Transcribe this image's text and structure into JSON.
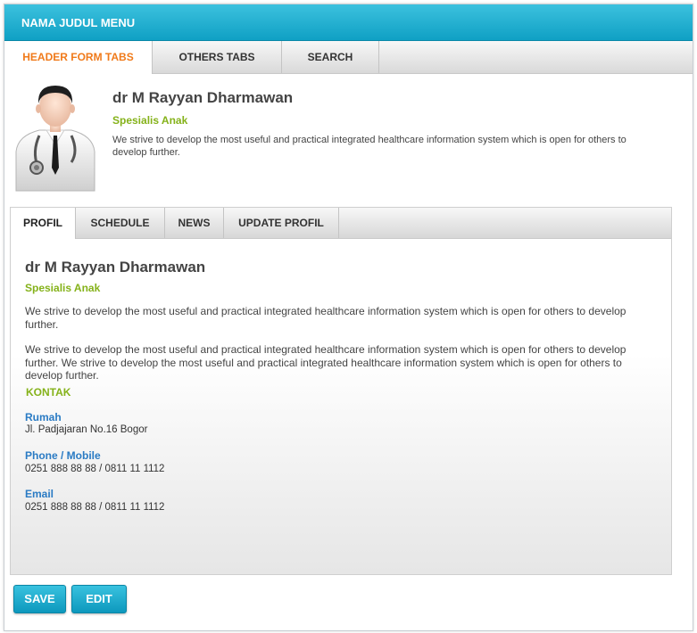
{
  "window": {
    "title": "NAMA JUDUL MENU"
  },
  "top_tabs": [
    {
      "label": "HEADER FORM TABS"
    },
    {
      "label": "OTHERS TABS"
    },
    {
      "label": "SEARCH"
    }
  ],
  "header": {
    "name": "dr M Rayyan Dharmawan",
    "specialty": "Spesialis Anak",
    "description": "We strive to develop the most useful and practical integrated healthcare information system which is open for others to develop further."
  },
  "inner_tabs": [
    {
      "label": "PROFIL"
    },
    {
      "label": "SCHEDULE"
    },
    {
      "label": "NEWS"
    },
    {
      "label": "UPDATE PROFIL"
    }
  ],
  "profile": {
    "name": "dr M Rayyan Dharmawan",
    "specialty": "Spesialis Anak",
    "paragraph1": "We strive to develop the most useful and practical integrated healthcare information system which is open for others to develop further.",
    "paragraph2": "We strive to develop the most useful and practical integrated healthcare information system which is open for others to develop further. We strive to develop the most useful and practical integrated healthcare information system which is open for others to develop further.",
    "kontak_title": "KONTAK",
    "contacts": [
      {
        "label": "Rumah",
        "value": "Jl. Padjajaran No.16 Bogor"
      },
      {
        "label": "Phone / Mobile",
        "value": "0251 888 88 88 / 0811 11 1112"
      },
      {
        "label": "Email",
        "value": "0251 888 88 88 / 0811 11 1112"
      }
    ]
  },
  "buttons": {
    "save": "SAVE",
    "edit": "EDIT"
  },
  "colors": {
    "accent": "#0fa0c4",
    "active_tab": "#f07a1a",
    "specialty": "#85b21a",
    "contact_label": "#2a7bc4"
  },
  "icons": {
    "avatar": "doctor-avatar-icon"
  }
}
